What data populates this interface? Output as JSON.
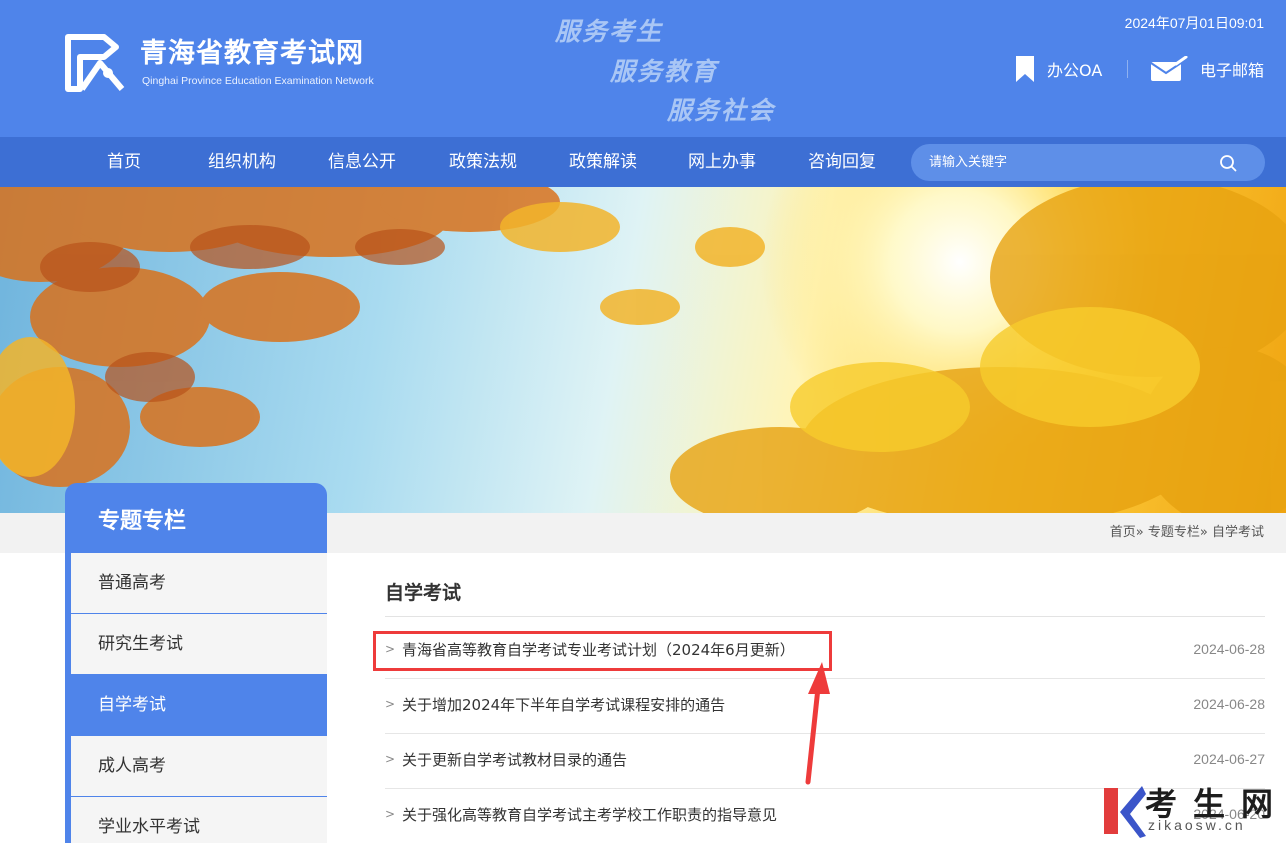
{
  "header": {
    "site_name_cn": "青海省教育考试网",
    "site_name_en": "Qinghai Province Education Examination Network",
    "slogans": [
      "服务考生",
      "服务教育",
      "服务社会"
    ],
    "datetime": "2024年07月01日09:01",
    "office_oa": "办公OA",
    "email": "电子邮箱"
  },
  "nav": {
    "items": [
      "首页",
      "组织机构",
      "信息公开",
      "政策法规",
      "政策解读",
      "网上办事",
      "咨询回复"
    ],
    "search_placeholder": "请输入关键字"
  },
  "breadcrumb": [
    "首页»",
    "专题专栏»",
    "自学考试"
  ],
  "sidebar": {
    "title": "专题专栏",
    "items": [
      "普通高考",
      "研究生考试",
      "自学考试",
      "成人高考",
      "学业水平考试"
    ],
    "active_index": 2
  },
  "main": {
    "title": "自学考试",
    "news": [
      {
        "title": "青海省高等教育自学考试专业考试计划（2024年6月更新）",
        "date": "2024-06-28"
      },
      {
        "title": "关于增加2024年下半年自学考试课程安排的通告",
        "date": "2024-06-28"
      },
      {
        "title": "关于更新自学考试教材目录的通告",
        "date": "2024-06-27"
      },
      {
        "title": "关于强化高等教育自学考试主考学校工作职责的指导意见",
        "date": "2024-06-20"
      }
    ]
  },
  "watermark": {
    "text": "考生网",
    "sub": "zikaosw.cn"
  },
  "colors": {
    "primary": "#4f84ea",
    "nav": "#3d6fd4",
    "highlight": "#ee3b3b"
  }
}
